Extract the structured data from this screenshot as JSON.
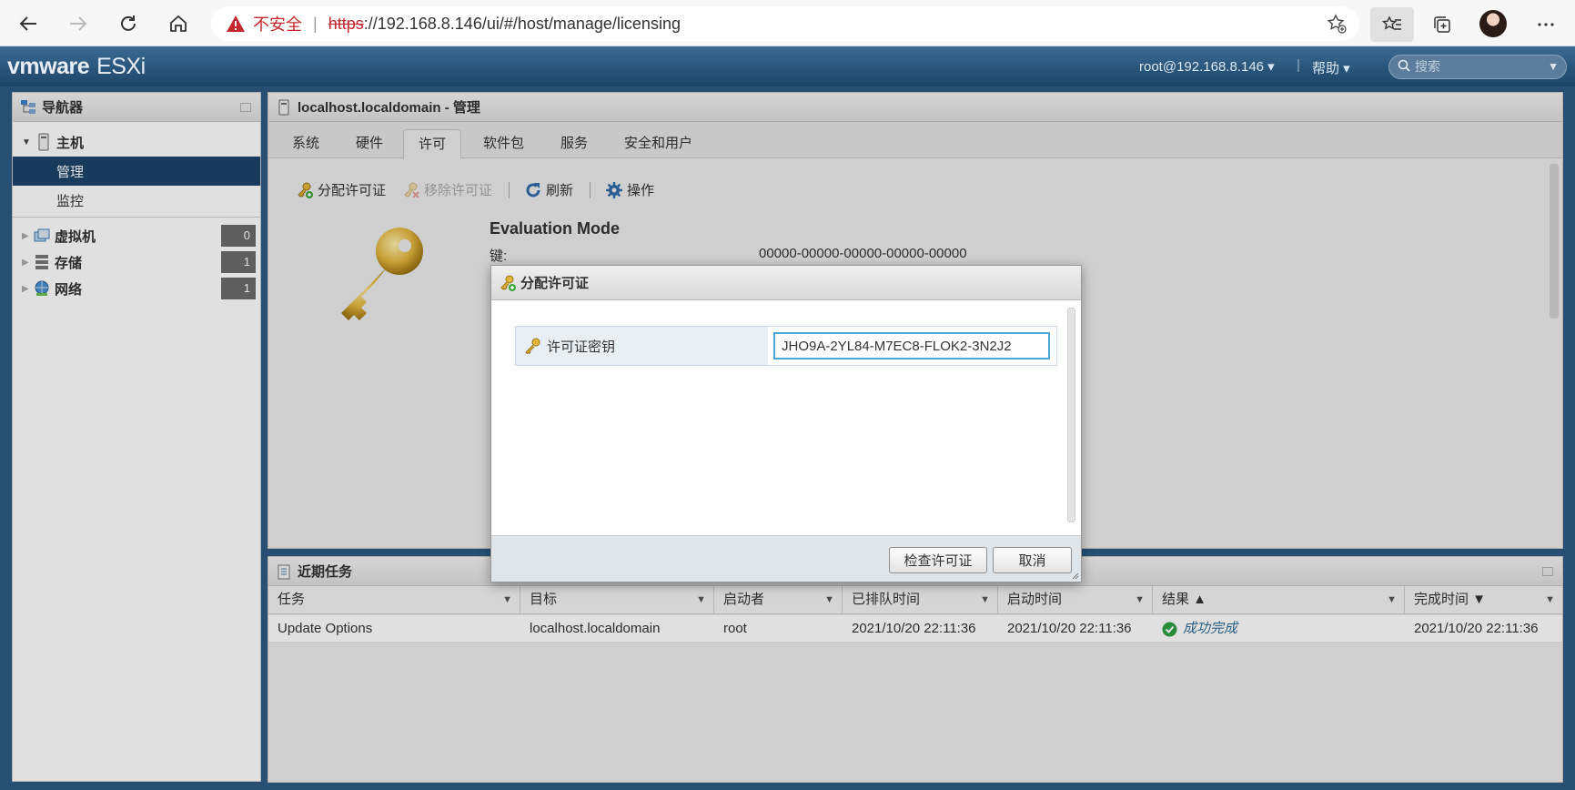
{
  "browser": {
    "insecure_label": "不安全",
    "url_scheme": "https",
    "url_rest": "://192.168.8.146/ui/#/host/manage/licensing"
  },
  "header": {
    "logo_brand": "vmware",
    "logo_product": "ESXi",
    "user": "root@192.168.8.146 ▾",
    "help": "帮助 ▾",
    "search_placeholder": "搜索"
  },
  "navigator": {
    "title": "导航器",
    "host": {
      "label": "主机",
      "children": [
        {
          "label": "管理"
        },
        {
          "label": "监控"
        }
      ]
    },
    "items": [
      {
        "label": "虚拟机",
        "count": "0"
      },
      {
        "label": "存储",
        "count": "1"
      },
      {
        "label": "网络",
        "count": "1"
      }
    ]
  },
  "main": {
    "title": "localhost.localdomain - 管理",
    "tabs": [
      "系统",
      "硬件",
      "许可",
      "软件包",
      "服务",
      "安全和用户"
    ],
    "active_tab": "许可",
    "toolbar": {
      "assign": "分配许可证",
      "remove": "移除许可证",
      "refresh": "刷新",
      "actions": "操作"
    },
    "license": {
      "mode": "Evaluation Mode",
      "key_label": "键:",
      "key_value": "00000-00000-00000-00000-00000"
    }
  },
  "tasks": {
    "title": "近期任务",
    "columns": [
      "任务",
      "目标",
      "启动者",
      "已排队时间",
      "启动时间",
      "结果 ▲",
      "完成时间 ▼"
    ],
    "rows": [
      {
        "task": "Update Options",
        "target": "localhost.localdomain",
        "initiator": "root",
        "queued": "2021/10/20 22:11:36",
        "started": "2021/10/20 22:11:36",
        "result": "成功完成",
        "completed": "2021/10/20 22:11:36"
      }
    ]
  },
  "modal": {
    "title": "分配许可证",
    "field_label": "许可证密钥",
    "field_value": "JHO9A-2YL84-M7EC8-FLOK2-3N2J2",
    "check_button": "检查许可证",
    "cancel_button": "取消"
  },
  "colors": {
    "header": "#1d4468",
    "selected_nav": "#1d4468",
    "insecure": "#c4272d",
    "input_focus": "#49a4d8",
    "success": "#2ea043"
  }
}
